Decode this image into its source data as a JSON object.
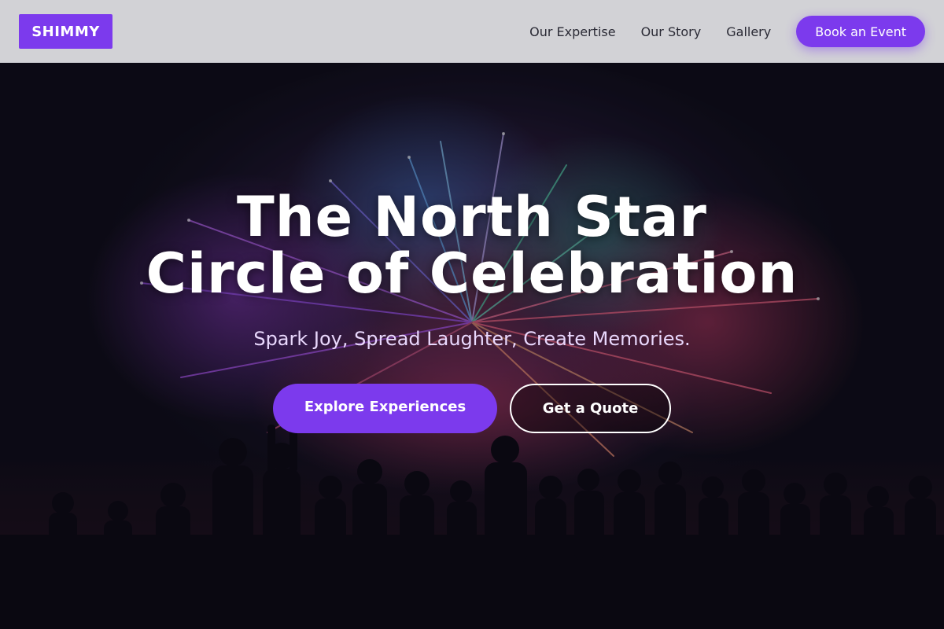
{
  "header": {
    "logo": "SHIMMY",
    "nav": [
      {
        "label": "Our Expertise"
      },
      {
        "label": "Our Story"
      },
      {
        "label": "Gallery"
      }
    ],
    "cta": "Book an Event"
  },
  "hero": {
    "title_line1": "The North Star",
    "title_line2": "Circle of Celebration",
    "subtitle": "Spark Joy, Spread Laughter, Create Memories.",
    "primary_button": "Explore Experiences",
    "secondary_button": "Get a Quote",
    "background": "fireworks-crowd-photo"
  },
  "colors": {
    "brand": "#7c3aed",
    "header_bg": "#d2d2d6",
    "hero_bg": "#0e0c17",
    "subtitle": "#e9d8fd"
  }
}
